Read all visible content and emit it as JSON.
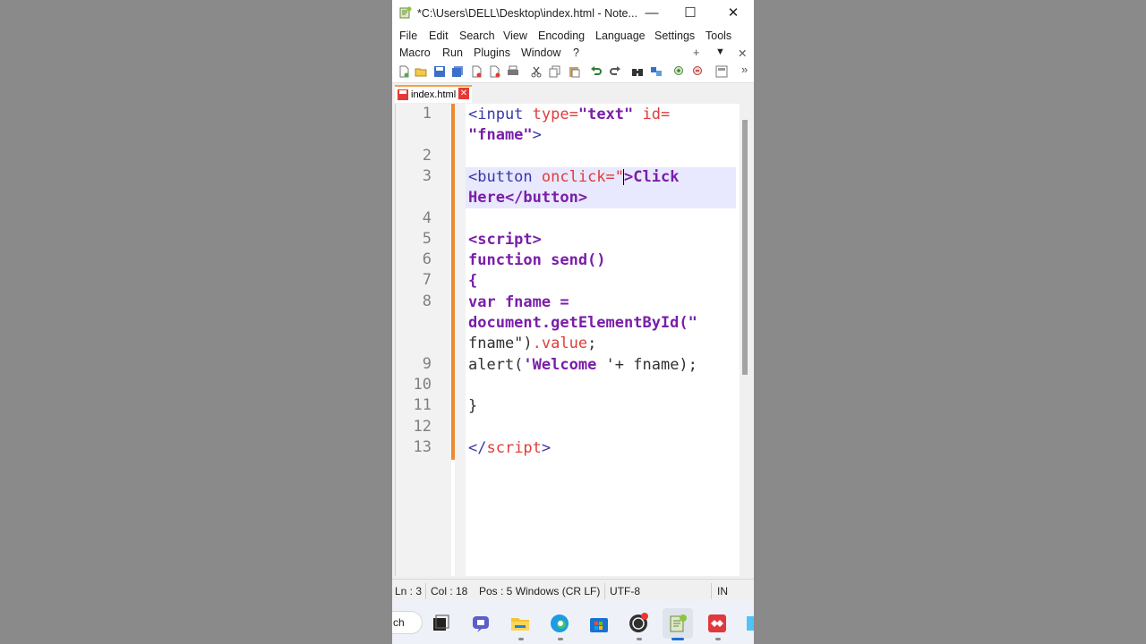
{
  "window": {
    "title": "*C:\\Users\\DELL\\Desktop\\index.html - Note...",
    "controls": {
      "minimize": "—",
      "maximize": "☐",
      "close": "✕"
    }
  },
  "menu": {
    "row1": [
      "File",
      "Edit",
      "Search",
      "View",
      "Encoding",
      "Language",
      "Settings",
      "Tools"
    ],
    "row2": [
      "Macro",
      "Run",
      "Plugins",
      "Window",
      "?"
    ],
    "right": {
      "plus": "+",
      "down": "▼",
      "close": "✕"
    }
  },
  "toolbar": {
    "more": "»"
  },
  "tab": {
    "label": "index.html",
    "close": "✕"
  },
  "editor": {
    "line_numbers": [
      "1",
      "2",
      "3",
      "4",
      "5",
      "6",
      "7",
      "8",
      "9",
      "10",
      "11",
      "12",
      "13"
    ],
    "lines": [
      [
        {
          "c": "t",
          "t": "<input "
        },
        {
          "c": "a",
          "t": "type="
        },
        {
          "c": "s",
          "t": "\"text\""
        },
        {
          "c": "a",
          "t": " id="
        }
      ],
      [
        {
          "c": "s",
          "t": "\"fname\""
        },
        {
          "c": "t",
          "t": ">"
        }
      ],
      [],
      [
        {
          "c": "t",
          "t": "<button "
        },
        {
          "c": "a",
          "t": "onclick="
        },
        {
          "c": "a",
          "t": "\""
        },
        {
          "c": "caret",
          "t": ""
        },
        {
          "c": "s",
          "t": ">Click"
        }
      ],
      [
        {
          "c": "s",
          "t": "Here</button>"
        }
      ],
      [],
      [
        {
          "c": "k",
          "t": "<script>"
        }
      ],
      [
        {
          "c": "k",
          "t": "function send()"
        }
      ],
      [
        {
          "c": "k",
          "t": "{"
        }
      ],
      [
        {
          "c": "k",
          "t": "var fname ="
        }
      ],
      [
        {
          "c": "k",
          "t": "document.getElementById(\""
        }
      ],
      [
        {
          "c": "p",
          "t": "fname\")"
        },
        {
          "c": "a",
          "t": ".value"
        },
        {
          "c": "p",
          "t": ";"
        }
      ],
      [
        {
          "c": "p",
          "t": "alert("
        },
        {
          "c": "s",
          "t": "'Welcome "
        },
        {
          "c": "p",
          "t": "'+ fname);"
        }
      ],
      [],
      [
        {
          "c": "p",
          "t": "}"
        }
      ],
      [],
      [
        {
          "c": "t",
          "t": "</"
        },
        {
          "c": "a",
          "t": "script"
        },
        {
          "c": "t",
          "t": ">"
        }
      ]
    ]
  },
  "status": {
    "ln": "Ln : 3",
    "col": "Col : 18",
    "pos": "Pos : 5 Windows (CR LF)",
    "encoding": "UTF-8",
    "mode": "IN"
  },
  "taskbar": {
    "search_fragment": "ch",
    "apps": [
      "task-view",
      "teams",
      "file-explorer",
      "edge",
      "store",
      "obs",
      "notepad-plus-plus",
      "anydesk",
      "more"
    ]
  }
}
